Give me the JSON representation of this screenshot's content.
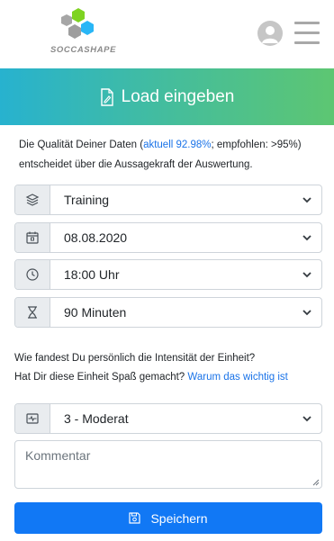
{
  "header": {
    "logo_text": "SOCCASHAPE",
    "logo_icon": "hexagons-logo-icon",
    "avatar_icon": "user-avatar-icon",
    "menu_icon": "hamburger-menu-icon"
  },
  "banner": {
    "icon": "file-edit-icon",
    "title": "Load eingeben"
  },
  "quality": {
    "prefix": "Die Qualität Deiner Daten (",
    "link": "aktuell 92.98%",
    "suffix": "; empfohlen: >95%) entscheidet über die Aussagekraft der Auswertung."
  },
  "form": {
    "type": {
      "icon": "layers-icon",
      "value": "Training"
    },
    "date": {
      "icon": "calendar-icon",
      "value": "08.08.2020"
    },
    "time": {
      "icon": "clock-icon",
      "value": "18:00 Uhr"
    },
    "duration": {
      "icon": "hourglass-icon",
      "value": "90 Minuten"
    },
    "question_line1": "Wie fandest Du persönlich die Intensität der Einheit?",
    "question_line2": "Hat Dir diese Einheit Spaß gemacht?",
    "question_link": "Warum das wichtig ist",
    "intensity": {
      "icon": "activity-icon",
      "value": "3 - Moderat"
    },
    "comment_placeholder": "Kommentar",
    "save_icon": "save-icon",
    "save_label": "Speichern"
  },
  "colors": {
    "banner_gradient_start": "#27b2cf",
    "banner_gradient_end": "#5dc672",
    "primary_button": "#1178f5",
    "link": "#1a73e8",
    "logo_gray": "#a0a0a0",
    "logo_green": "#7ed321",
    "logo_blue": "#29b6f6"
  }
}
